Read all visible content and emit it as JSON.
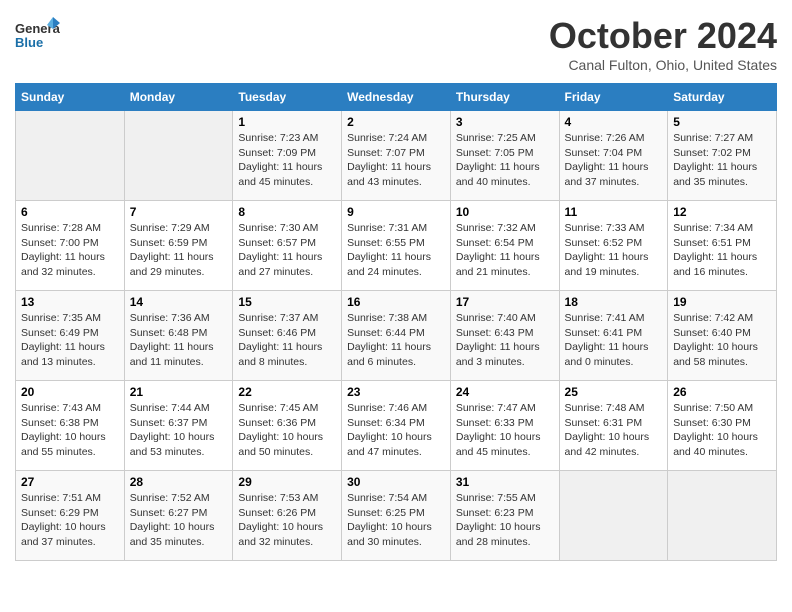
{
  "header": {
    "logo_line1": "General",
    "logo_line2": "Blue",
    "title": "October 2024",
    "location": "Canal Fulton, Ohio, United States"
  },
  "days_of_week": [
    "Sunday",
    "Monday",
    "Tuesday",
    "Wednesday",
    "Thursday",
    "Friday",
    "Saturday"
  ],
  "weeks": [
    [
      {
        "num": "",
        "info": ""
      },
      {
        "num": "",
        "info": ""
      },
      {
        "num": "1",
        "info": "Sunrise: 7:23 AM\nSunset: 7:09 PM\nDaylight: 11 hours and 45 minutes."
      },
      {
        "num": "2",
        "info": "Sunrise: 7:24 AM\nSunset: 7:07 PM\nDaylight: 11 hours and 43 minutes."
      },
      {
        "num": "3",
        "info": "Sunrise: 7:25 AM\nSunset: 7:05 PM\nDaylight: 11 hours and 40 minutes."
      },
      {
        "num": "4",
        "info": "Sunrise: 7:26 AM\nSunset: 7:04 PM\nDaylight: 11 hours and 37 minutes."
      },
      {
        "num": "5",
        "info": "Sunrise: 7:27 AM\nSunset: 7:02 PM\nDaylight: 11 hours and 35 minutes."
      }
    ],
    [
      {
        "num": "6",
        "info": "Sunrise: 7:28 AM\nSunset: 7:00 PM\nDaylight: 11 hours and 32 minutes."
      },
      {
        "num": "7",
        "info": "Sunrise: 7:29 AM\nSunset: 6:59 PM\nDaylight: 11 hours and 29 minutes."
      },
      {
        "num": "8",
        "info": "Sunrise: 7:30 AM\nSunset: 6:57 PM\nDaylight: 11 hours and 27 minutes."
      },
      {
        "num": "9",
        "info": "Sunrise: 7:31 AM\nSunset: 6:55 PM\nDaylight: 11 hours and 24 minutes."
      },
      {
        "num": "10",
        "info": "Sunrise: 7:32 AM\nSunset: 6:54 PM\nDaylight: 11 hours and 21 minutes."
      },
      {
        "num": "11",
        "info": "Sunrise: 7:33 AM\nSunset: 6:52 PM\nDaylight: 11 hours and 19 minutes."
      },
      {
        "num": "12",
        "info": "Sunrise: 7:34 AM\nSunset: 6:51 PM\nDaylight: 11 hours and 16 minutes."
      }
    ],
    [
      {
        "num": "13",
        "info": "Sunrise: 7:35 AM\nSunset: 6:49 PM\nDaylight: 11 hours and 13 minutes."
      },
      {
        "num": "14",
        "info": "Sunrise: 7:36 AM\nSunset: 6:48 PM\nDaylight: 11 hours and 11 minutes."
      },
      {
        "num": "15",
        "info": "Sunrise: 7:37 AM\nSunset: 6:46 PM\nDaylight: 11 hours and 8 minutes."
      },
      {
        "num": "16",
        "info": "Sunrise: 7:38 AM\nSunset: 6:44 PM\nDaylight: 11 hours and 6 minutes."
      },
      {
        "num": "17",
        "info": "Sunrise: 7:40 AM\nSunset: 6:43 PM\nDaylight: 11 hours and 3 minutes."
      },
      {
        "num": "18",
        "info": "Sunrise: 7:41 AM\nSunset: 6:41 PM\nDaylight: 11 hours and 0 minutes."
      },
      {
        "num": "19",
        "info": "Sunrise: 7:42 AM\nSunset: 6:40 PM\nDaylight: 10 hours and 58 minutes."
      }
    ],
    [
      {
        "num": "20",
        "info": "Sunrise: 7:43 AM\nSunset: 6:38 PM\nDaylight: 10 hours and 55 minutes."
      },
      {
        "num": "21",
        "info": "Sunrise: 7:44 AM\nSunset: 6:37 PM\nDaylight: 10 hours and 53 minutes."
      },
      {
        "num": "22",
        "info": "Sunrise: 7:45 AM\nSunset: 6:36 PM\nDaylight: 10 hours and 50 minutes."
      },
      {
        "num": "23",
        "info": "Sunrise: 7:46 AM\nSunset: 6:34 PM\nDaylight: 10 hours and 47 minutes."
      },
      {
        "num": "24",
        "info": "Sunrise: 7:47 AM\nSunset: 6:33 PM\nDaylight: 10 hours and 45 minutes."
      },
      {
        "num": "25",
        "info": "Sunrise: 7:48 AM\nSunset: 6:31 PM\nDaylight: 10 hours and 42 minutes."
      },
      {
        "num": "26",
        "info": "Sunrise: 7:50 AM\nSunset: 6:30 PM\nDaylight: 10 hours and 40 minutes."
      }
    ],
    [
      {
        "num": "27",
        "info": "Sunrise: 7:51 AM\nSunset: 6:29 PM\nDaylight: 10 hours and 37 minutes."
      },
      {
        "num": "28",
        "info": "Sunrise: 7:52 AM\nSunset: 6:27 PM\nDaylight: 10 hours and 35 minutes."
      },
      {
        "num": "29",
        "info": "Sunrise: 7:53 AM\nSunset: 6:26 PM\nDaylight: 10 hours and 32 minutes."
      },
      {
        "num": "30",
        "info": "Sunrise: 7:54 AM\nSunset: 6:25 PM\nDaylight: 10 hours and 30 minutes."
      },
      {
        "num": "31",
        "info": "Sunrise: 7:55 AM\nSunset: 6:23 PM\nDaylight: 10 hours and 28 minutes."
      },
      {
        "num": "",
        "info": ""
      },
      {
        "num": "",
        "info": ""
      }
    ]
  ]
}
